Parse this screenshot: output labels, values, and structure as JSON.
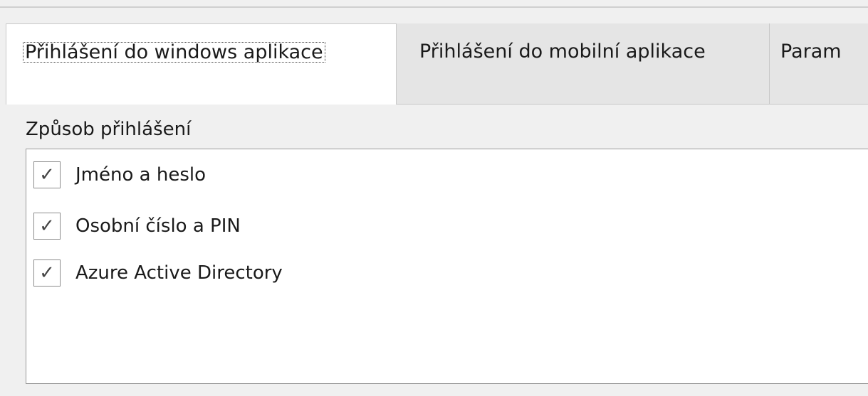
{
  "tabs": [
    {
      "label": "Přihlášení do windows aplikace",
      "active": true
    },
    {
      "label": "Přihlášení do mobilní aplikace",
      "active": false
    },
    {
      "label": "Param",
      "active": false
    }
  ],
  "panel": {
    "section_label": "Způsob přihlášení",
    "login_methods": [
      {
        "label": "Jméno a heslo",
        "checked": true,
        "check_glyph": "✓"
      },
      {
        "label": "Osobní číslo a PIN",
        "checked": true,
        "check_glyph": "✓"
      },
      {
        "label": "Azure Active Directory",
        "checked": true,
        "check_glyph": "✓"
      }
    ]
  }
}
